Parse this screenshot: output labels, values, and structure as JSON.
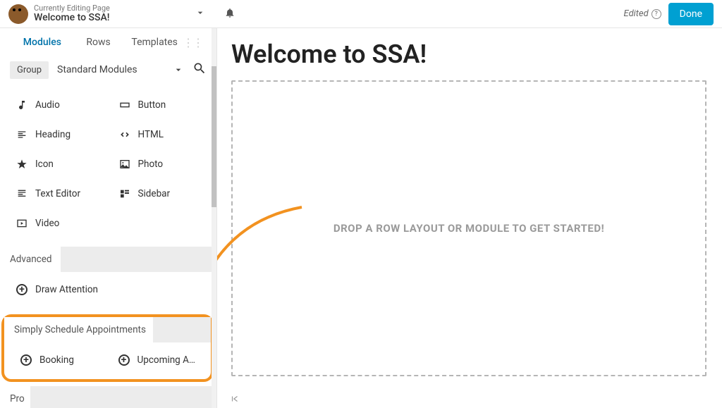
{
  "header": {
    "editLabel": "Currently Editing Page",
    "pageTitle": "Welcome to SSA!",
    "editedText": "Edited",
    "doneLabel": "Done"
  },
  "sidebar": {
    "tabs": {
      "modules": "Modules",
      "rows": "Rows",
      "templates": "Templates"
    },
    "filter": {
      "groupLabel": "Group",
      "selected": "Standard Modules"
    },
    "standard": {
      "audio": "Audio",
      "button": "Button",
      "heading": "Heading",
      "html": "HTML",
      "icon": "Icon",
      "photo": "Photo",
      "textEditor": "Text Editor",
      "sidebar": "Sidebar",
      "video": "Video"
    },
    "sections": {
      "advanced": "Advanced",
      "drawAttention": "Draw Attention",
      "ssa": "Simply Schedule Appointments",
      "booking": "Booking",
      "upcoming": "Upcoming A…",
      "pro": "Pro"
    }
  },
  "canvas": {
    "title": "Welcome to SSA!",
    "dropText": "DROP A ROW LAYOUT OR MODULE TO GET STARTED!"
  }
}
